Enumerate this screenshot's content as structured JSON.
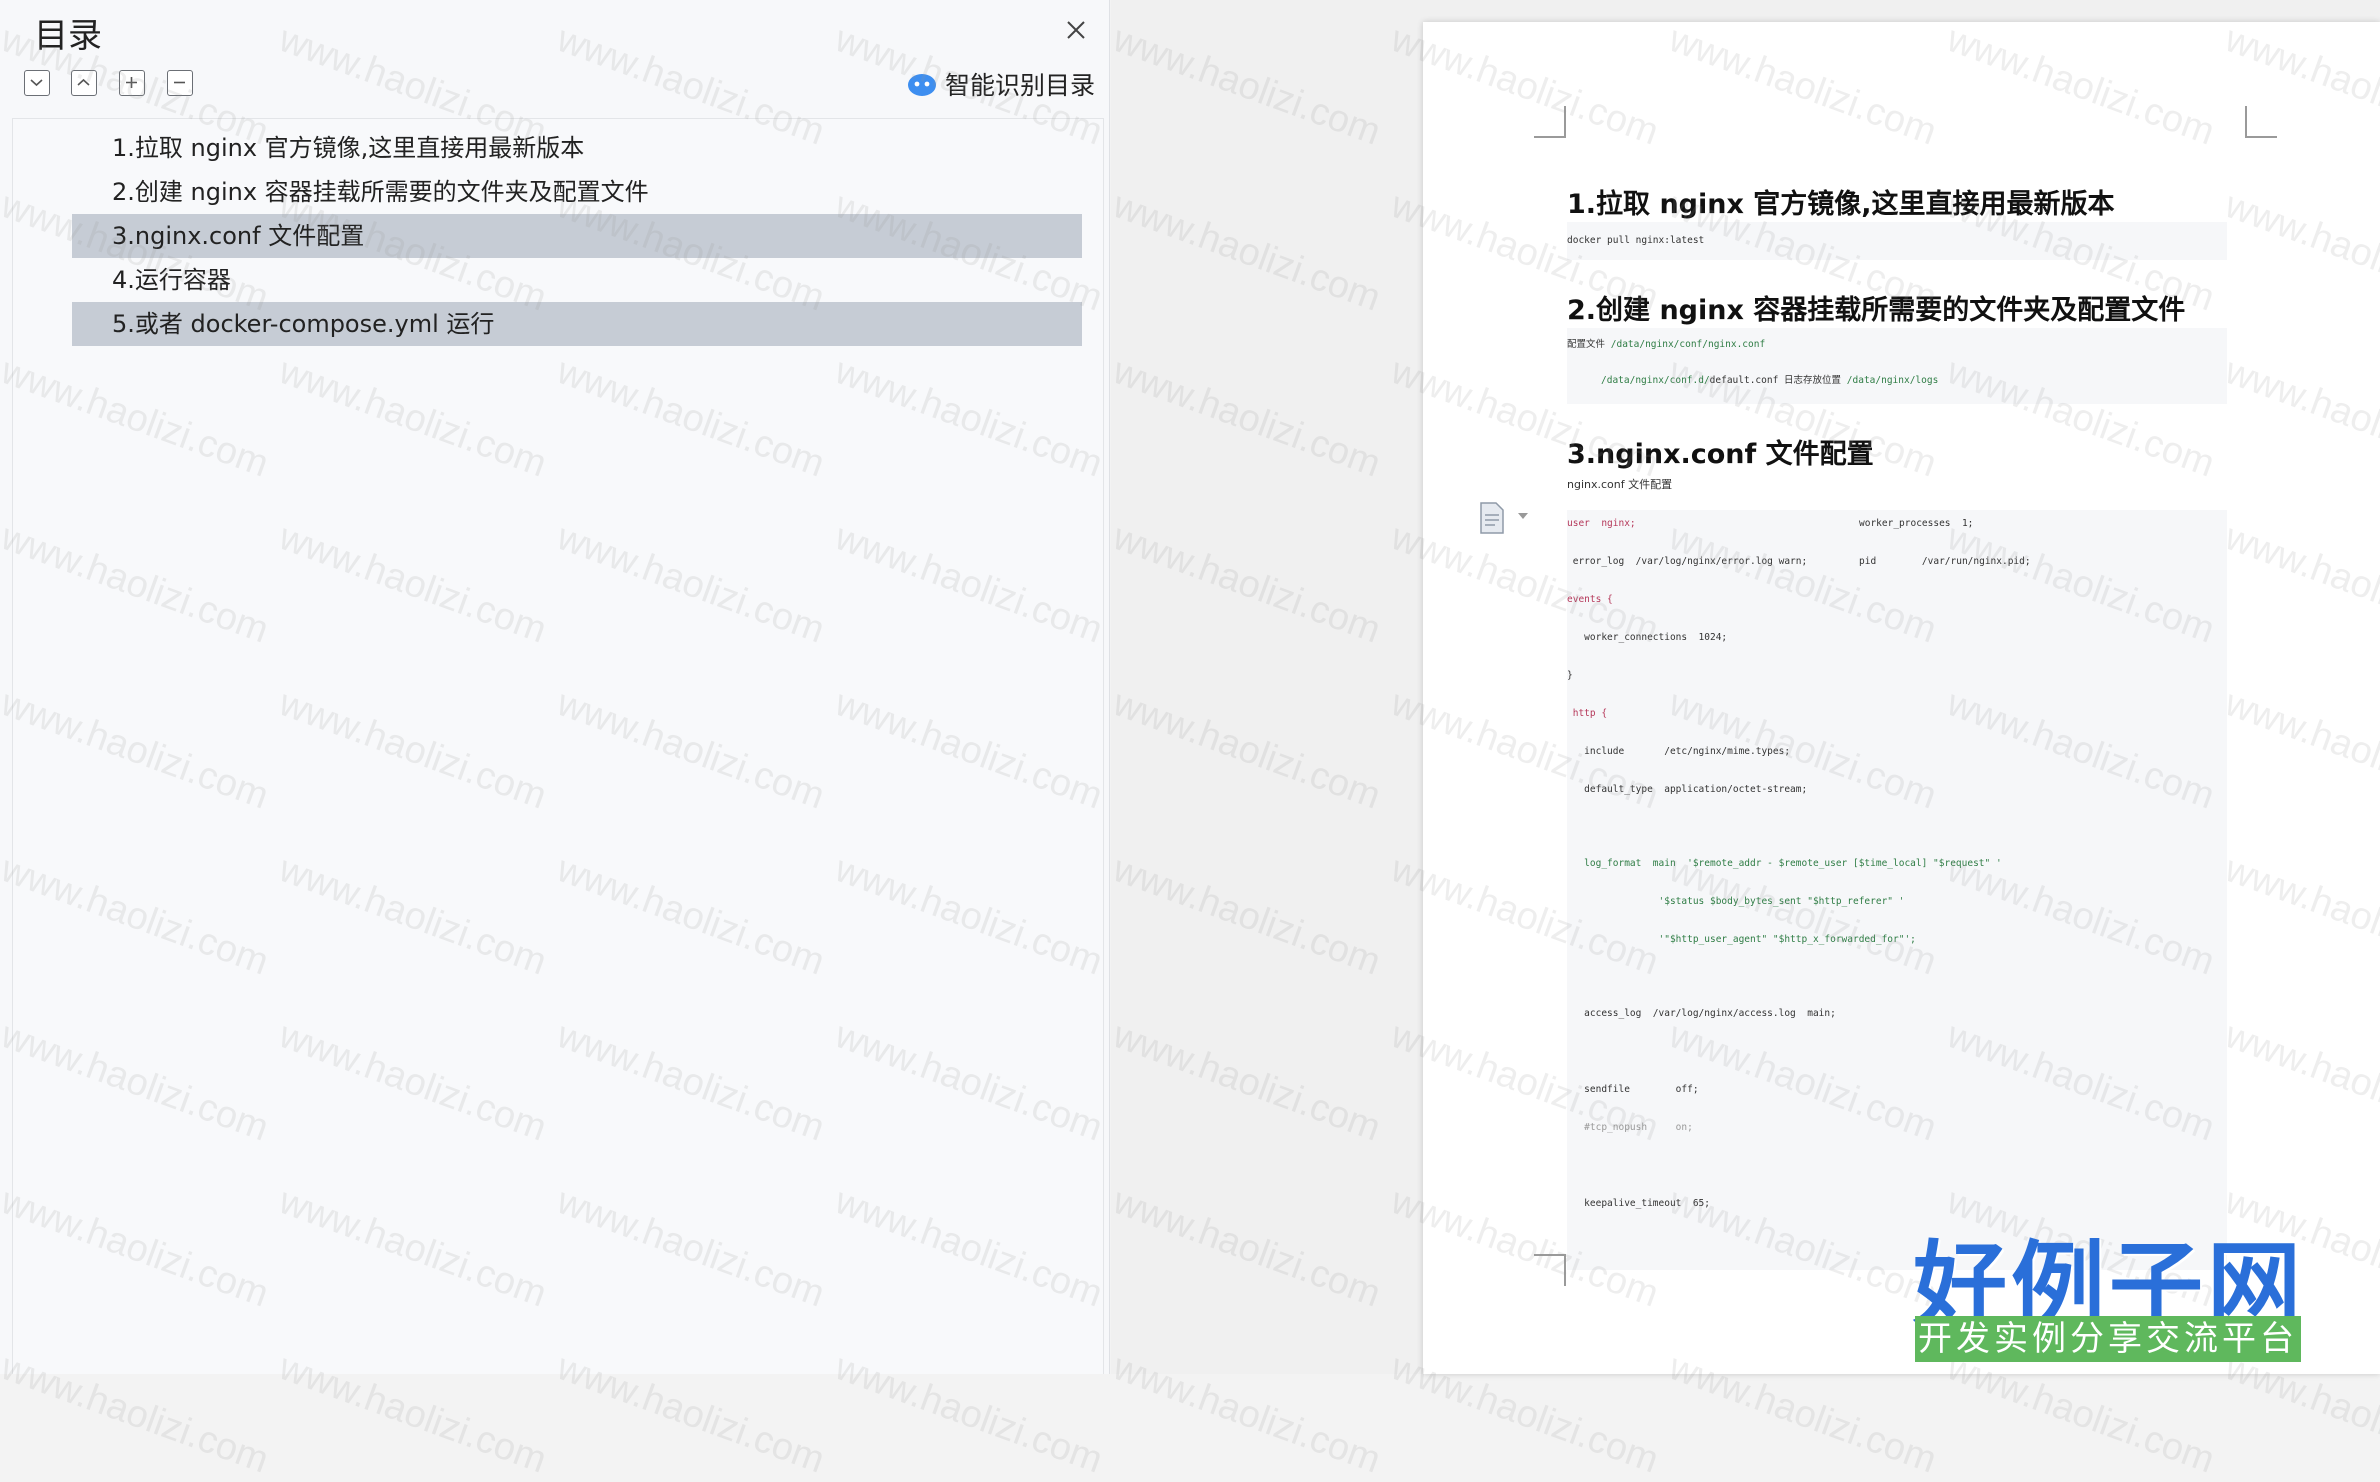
{
  "toc": {
    "title": "目录",
    "smart_label": "智能识别目录",
    "items": [
      {
        "label": "1.拉取 nginx 官方镜像,这里直接用最新版本",
        "selected": false
      },
      {
        "label": "2.创建 nginx 容器挂载所需要的文件夹及配置文件",
        "selected": false
      },
      {
        "label": "3.nginx.conf 文件配置",
        "selected": true
      },
      {
        "label": "4.运行容器",
        "selected": false
      },
      {
        "label": "5.或者 docker-compose.yml 运行",
        "selected": true
      }
    ]
  },
  "document": {
    "h1": "1.拉取 nginx 官方镜像,这里直接用最新版本",
    "code1": "docker pull nginx:latest",
    "h2": "2.创建 nginx 容器挂载所需要的文件夹及配置文件",
    "code2_line1_label": "配置文件",
    "code2_line1_path": "/data/nginx/conf/nginx.conf",
    "code2_line2_path1": "/data/nginx/conf.d/",
    "code2_line2_file": "default.conf",
    "code2_line2_label": "日志存放位置",
    "code2_line2_path2": "/data/nginx/logs",
    "h3": "3.nginx.conf 文件配置",
    "p3": "nginx.conf 文件配置",
    "config_lines": [
      {
        "a": "user  nginx;",
        "b": "worker_processes  1;"
      },
      {
        "a": " error_log  /var/log/nginx/error.log warn;",
        "b": "pid        /var/run/nginx.pid;"
      },
      {
        "a": "events {",
        "b": ""
      },
      {
        "a": "   worker_connections  1024;",
        "b": ""
      },
      {
        "a": "}",
        "b": ""
      },
      {
        "a": " http {",
        "b": ""
      },
      {
        "a": "   include       /etc/nginx/mime.types;",
        "b": ""
      },
      {
        "a": "   default_type  application/octet-stream;",
        "b": ""
      },
      {
        "a": "   log_format  main  '$remote_addr - $remote_user [$time_local] \"$request\" '",
        "b": ""
      },
      {
        "a": "                '$status $body_bytes_sent \"$http_referer\" '",
        "b": ""
      },
      {
        "a": "                '\"$http_user_agent\" \"$http_x_forwarded_for\"';",
        "b": ""
      },
      {
        "a": "   access_log  /var/log/nginx/access.log  main;",
        "b": ""
      },
      {
        "a": "   sendfile        off;",
        "b": ""
      },
      {
        "a": "   #tcp_nopush     on;",
        "b": ""
      },
      {
        "a": "   keepalive_timeout  65;",
        "b": ""
      }
    ]
  },
  "watermark": "www.haolizi.com",
  "logo": {
    "main": "好例子网",
    "sub": "开发实例分享交流平台"
  },
  "colors": {
    "selected_bg": "#c6ccd5",
    "logo_blue": "#2a6fd9",
    "logo_green": "#5fb85d"
  },
  "icons": {
    "close": "close-icon",
    "collapse": "chevron-down-icon",
    "expand": "chevron-up-icon",
    "plus": "plus-icon",
    "minus": "minus-icon",
    "smart": "robot-icon"
  }
}
